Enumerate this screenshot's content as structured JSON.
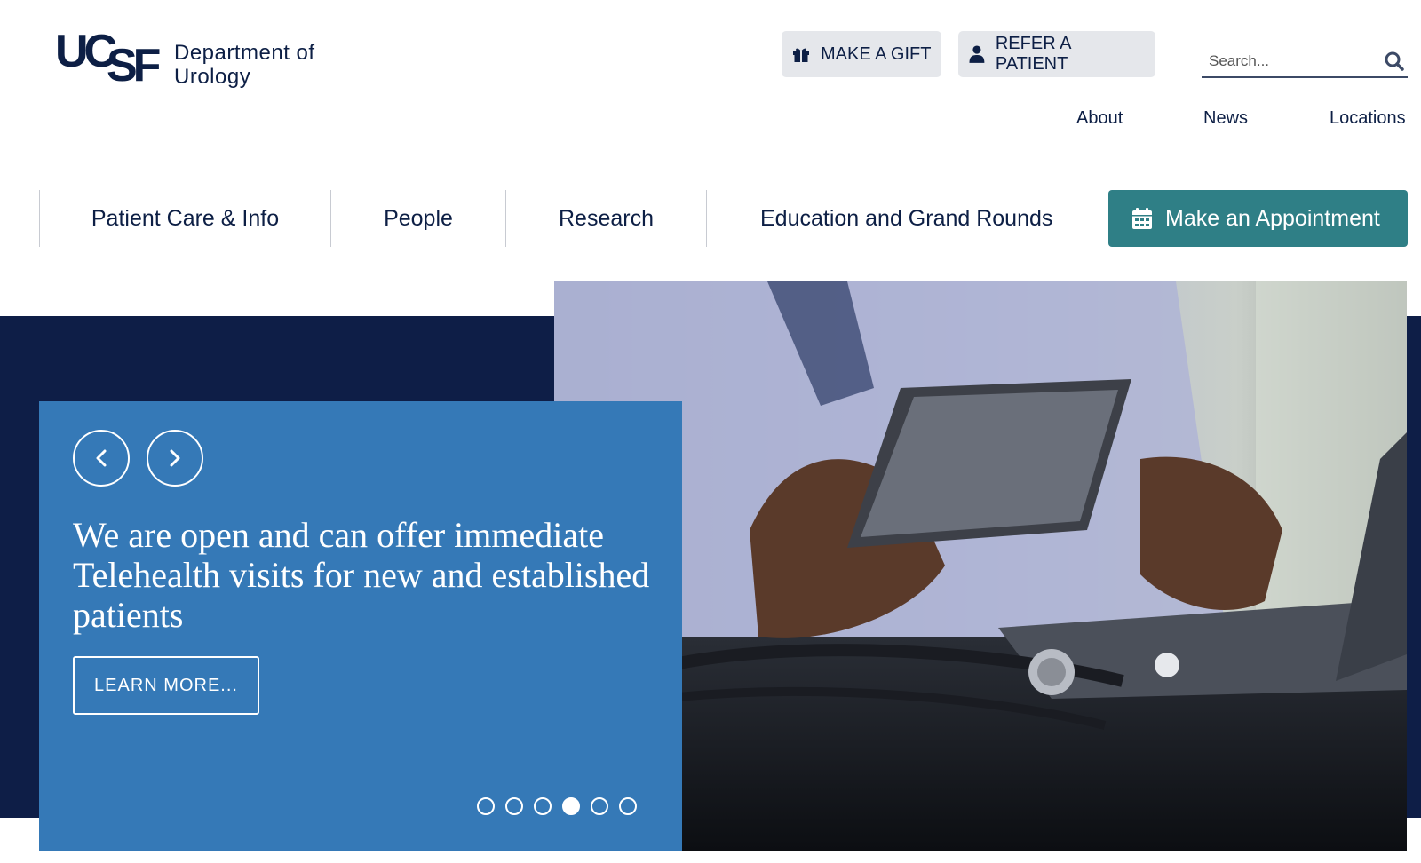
{
  "logo": {
    "mark_uc": "UC",
    "mark_sf": "SF",
    "dept_line1": "Department of",
    "dept_line2": "Urology"
  },
  "utility": {
    "gift_label": "MAKE A GIFT",
    "gift_icon": "gift-icon",
    "refer_label": "REFER A PATIENT",
    "refer_icon": "person-icon"
  },
  "search": {
    "placeholder": "Search...",
    "icon": "search-icon"
  },
  "top_links": {
    "about": "About",
    "news": "News",
    "locations": "Locations"
  },
  "main_nav": {
    "items": [
      {
        "label": "Patient Care & Info"
      },
      {
        "label": "People"
      },
      {
        "label": "Research"
      },
      {
        "label": "Education and Grand Rounds"
      }
    ],
    "appointment_label": "Make an Appointment",
    "appointment_icon": "calendar-icon"
  },
  "hero": {
    "headline": "We are open and can offer immediate Telehealth visits for new and established patients",
    "cta_label": "LEARN MORE...",
    "slide_count": 6,
    "active_slide": 4
  },
  "colors": {
    "navy": "#0e1e47",
    "card_blue": "#3579b7",
    "teal": "#2f7f86",
    "utility_gray": "#e5e7eb"
  }
}
